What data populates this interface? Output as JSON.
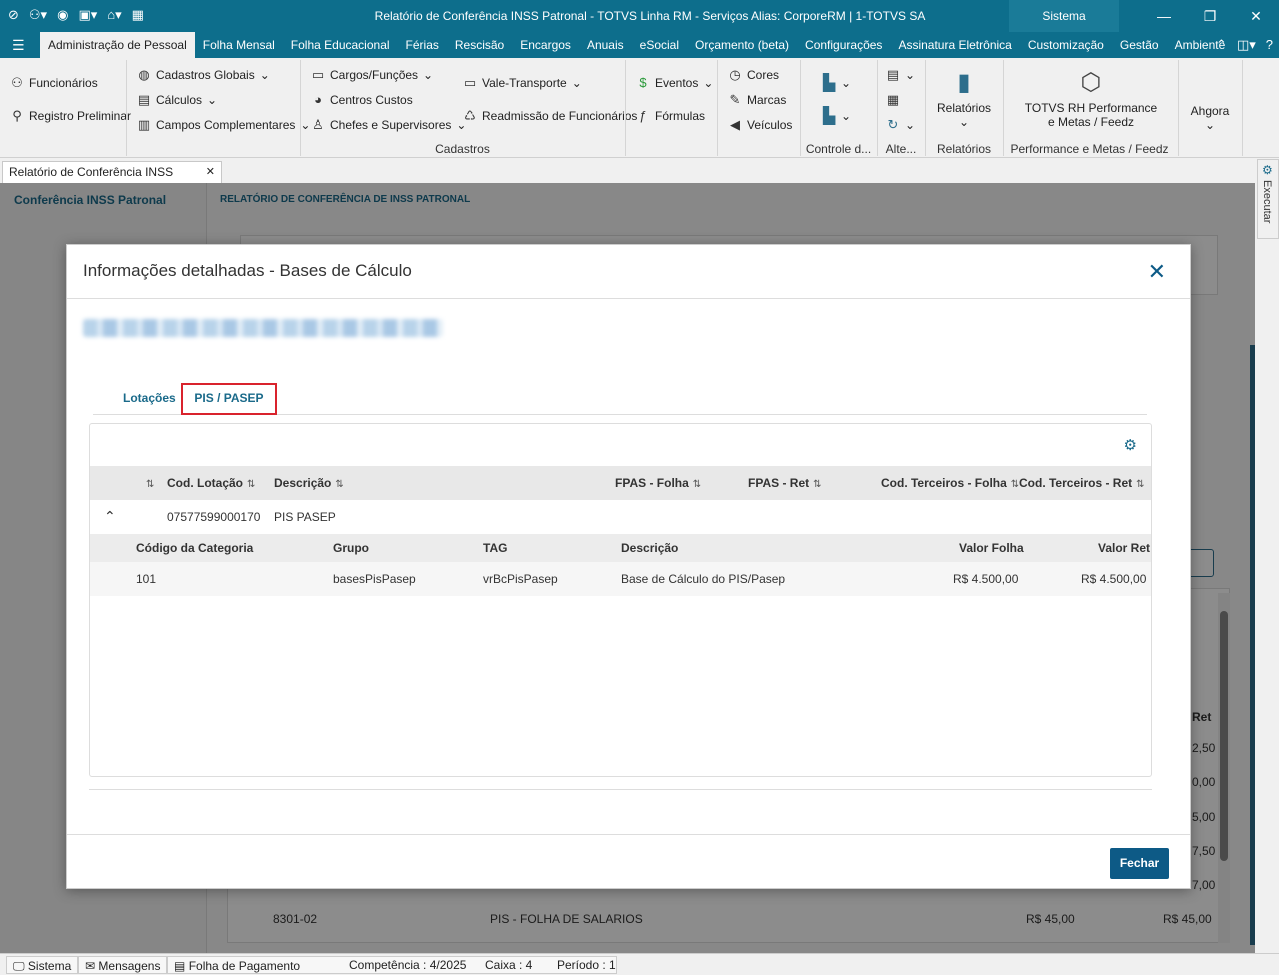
{
  "titlebar": {
    "title": "Relatório de Conferência INSS Patronal - TOTVS Linha RM - Serviços  Alias: CorporeRM | 1-TOTVS SA",
    "sistema": "Sistema"
  },
  "menu": {
    "tabs": [
      "Administração de Pessoal",
      "Folha Mensal",
      "Folha Educacional",
      "Férias",
      "Rescisão",
      "Encargos",
      "Anuais",
      "eSocial",
      "Orçamento (beta)",
      "Configurações",
      "Assinatura Eletrônica",
      "Customização",
      "Gestão",
      "Ambiente"
    ]
  },
  "ribbon": {
    "funcionarios": "Funcionários",
    "registro_preliminar": "Registro Preliminar",
    "cadastros_globais": "Cadastros Globais",
    "calculos": "Cálculos",
    "campos_complementares": "Campos Complementares",
    "cargos_funcoes": "Cargos/Funções",
    "centros_custos": "Centros Custos",
    "chefes_supervisores": "Chefes e Supervisores",
    "vale_transporte": "Vale-Transporte",
    "readmissao": "Readmissão de Funcionários",
    "eventos": "Eventos",
    "formulas": "Fórmulas",
    "cores": "Cores",
    "marcas": "Marcas",
    "veiculos": "Veículos",
    "relatorios": "Relatórios",
    "totvs_rh_line1": "TOTVS RH Performance",
    "totvs_rh_line2": "e Metas / Feedz",
    "ahgora": "Ahgora",
    "group_cadastros": "Cadastros",
    "group_controle": "Controle d...",
    "group_alte": "Alte...",
    "group_relatorios": "Relatórios",
    "group_performance": "Performance e Metas / Feedz"
  },
  "doc_tab": {
    "label": "Relatório de Conferência INSS Patronal"
  },
  "background": {
    "left_title": "Conferência INSS Patronal",
    "right_title": "RELATÓRIO DE CONFERÊNCIA DE INSS PATRONAL",
    "partial_ret": "Ret",
    "partial_values": [
      "2,50",
      "0,00",
      "5,00",
      "7,50",
      "7,00"
    ],
    "row_code": "8301-02",
    "row_desc": "PIS - FOLHA DE SALARIOS",
    "row_v1": "R$ 45,00",
    "row_v2": "R$ 45,00",
    "exec_label": "Executar"
  },
  "modal": {
    "title": "Informações detalhadas - Bases de Cálculo",
    "tabs": {
      "lotacoes": "Lotações",
      "pis_pasep": "PIS / PASEP"
    },
    "grid_headers": {
      "cod_lotacao": "Cod. Lotação",
      "descricao": "Descrição",
      "fpas_folha": "FPAS - Folha",
      "fpas_ret": "FPAS - Ret",
      "cod_terceiros_folha": "Cod. Terceiros - Folha",
      "cod_terceiros_ret": "Cod. Terceiros - Ret"
    },
    "row": {
      "cod_lotacao": "07577599000170",
      "descricao": "PIS PASEP"
    },
    "sub_headers": {
      "codigo_categoria": "Código da Categoria",
      "grupo": "Grupo",
      "tag": "TAG",
      "descricao": "Descrição",
      "valor_folha": "Valor Folha",
      "valor_ret": "Valor Ret"
    },
    "sub_row": {
      "codigo_categoria": "101",
      "grupo": "basesPisPasep",
      "tag": "vrBcPisPasep",
      "descricao": "Base de Cálculo do PIS/Pasep",
      "valor_folha": "R$ 4.500,00",
      "valor_ret": "R$ 4.500,00"
    },
    "close_button": "Fechar"
  },
  "statusbar": {
    "sistema": "Sistema",
    "mensagens": "Mensagens",
    "folha": "Folha de Pagamento",
    "competencia": "Competência : 4/2025",
    "caixa": "Caixa : 4",
    "periodo": "Período : 1"
  }
}
